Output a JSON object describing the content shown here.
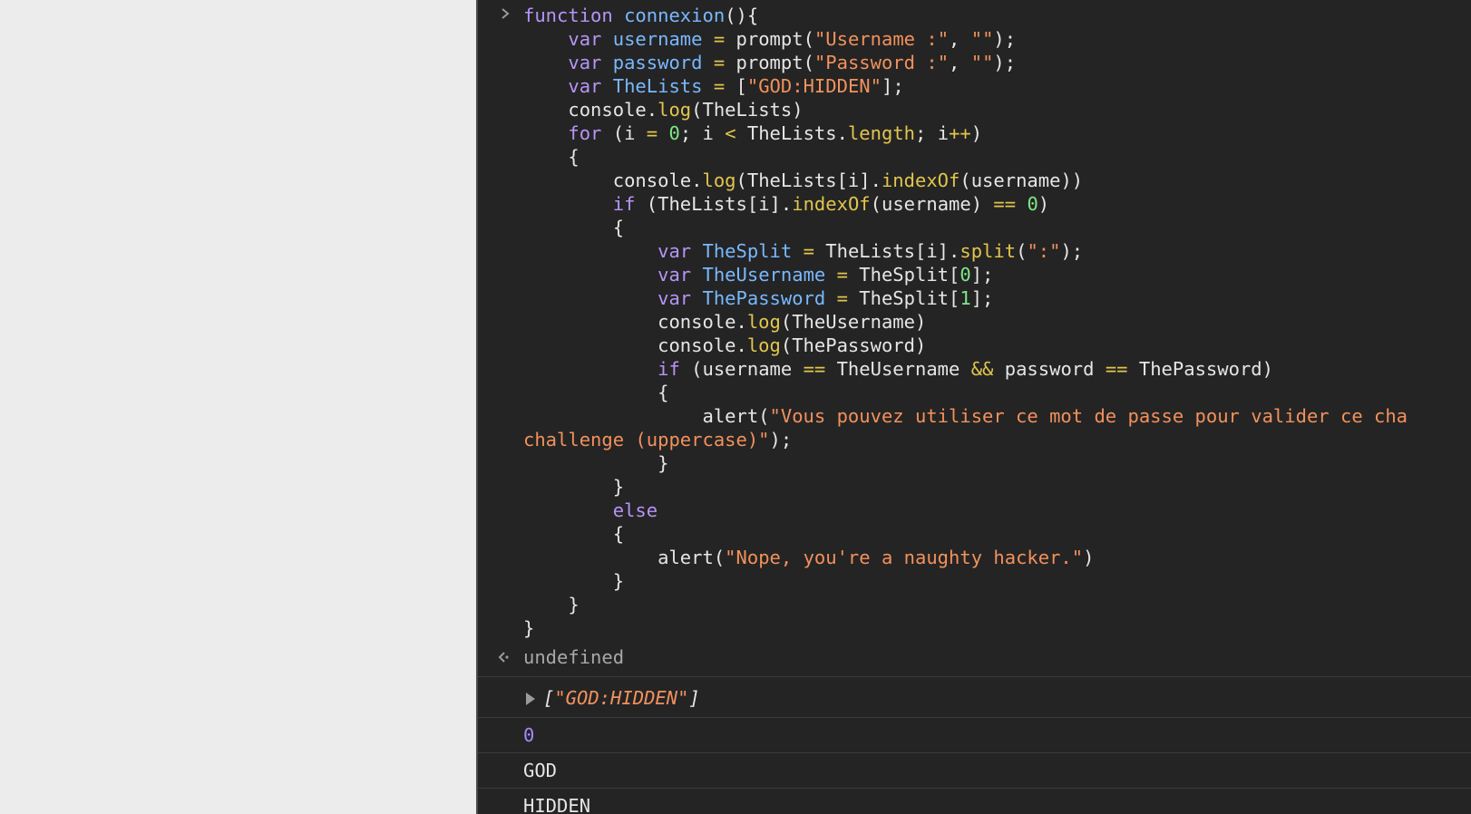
{
  "console": {
    "input_code": [
      [
        [
          "kw",
          "function "
        ],
        [
          "fn",
          "connexion"
        ],
        [
          "plain",
          "(){"
        ]
      ],
      [
        [
          "plain",
          "    "
        ],
        [
          "kw",
          "var "
        ],
        [
          "var",
          "username "
        ],
        [
          "op",
          "= "
        ],
        [
          "plain",
          "prompt("
        ],
        [
          "str",
          "\"Username :\""
        ],
        [
          "plain",
          ", "
        ],
        [
          "str",
          "\"\""
        ],
        [
          "plain",
          ");"
        ]
      ],
      [
        [
          "plain",
          "    "
        ],
        [
          "kw",
          "var "
        ],
        [
          "var",
          "password "
        ],
        [
          "op",
          "= "
        ],
        [
          "plain",
          "prompt("
        ],
        [
          "str",
          "\"Password :\""
        ],
        [
          "plain",
          ", "
        ],
        [
          "str",
          "\"\""
        ],
        [
          "plain",
          ");"
        ]
      ],
      [
        [
          "plain",
          "    "
        ],
        [
          "kw",
          "var "
        ],
        [
          "var",
          "TheLists "
        ],
        [
          "op",
          "= "
        ],
        [
          "plain",
          "["
        ],
        [
          "str",
          "\"GOD:HIDDEN\""
        ],
        [
          "plain",
          "];"
        ]
      ],
      [
        [
          "plain",
          "    console."
        ],
        [
          "method",
          "log"
        ],
        [
          "plain",
          "(TheLists)"
        ]
      ],
      [
        [
          "plain",
          "    "
        ],
        [
          "kw",
          "for "
        ],
        [
          "plain",
          "(i "
        ],
        [
          "op",
          "= "
        ],
        [
          "num",
          "0"
        ],
        [
          "plain",
          "; i "
        ],
        [
          "op",
          "< "
        ],
        [
          "plain",
          "TheLists."
        ],
        [
          "method",
          "length"
        ],
        [
          "plain",
          "; i"
        ],
        [
          "op",
          "++"
        ],
        [
          "plain",
          ")"
        ]
      ],
      [
        [
          "plain",
          "    {"
        ]
      ],
      [
        [
          "plain",
          "        console."
        ],
        [
          "method",
          "log"
        ],
        [
          "plain",
          "(TheLists[i]."
        ],
        [
          "method",
          "indexOf"
        ],
        [
          "plain",
          "(username))"
        ]
      ],
      [
        [
          "plain",
          "        "
        ],
        [
          "kw",
          "if "
        ],
        [
          "plain",
          "(TheLists[i]."
        ],
        [
          "method",
          "indexOf"
        ],
        [
          "plain",
          "(username) "
        ],
        [
          "op",
          "== "
        ],
        [
          "num",
          "0"
        ],
        [
          "plain",
          ")"
        ]
      ],
      [
        [
          "plain",
          "        {"
        ]
      ],
      [
        [
          "plain",
          "            "
        ],
        [
          "kw",
          "var "
        ],
        [
          "var",
          "TheSplit "
        ],
        [
          "op",
          "= "
        ],
        [
          "plain",
          "TheLists[i]."
        ],
        [
          "method",
          "split"
        ],
        [
          "plain",
          "("
        ],
        [
          "str",
          "\":\""
        ],
        [
          "plain",
          ");"
        ]
      ],
      [
        [
          "plain",
          "            "
        ],
        [
          "kw",
          "var "
        ],
        [
          "var",
          "TheUsername "
        ],
        [
          "op",
          "= "
        ],
        [
          "plain",
          "TheSplit["
        ],
        [
          "num",
          "0"
        ],
        [
          "plain",
          "];"
        ]
      ],
      [
        [
          "plain",
          "            "
        ],
        [
          "kw",
          "var "
        ],
        [
          "var",
          "ThePassword "
        ],
        [
          "op",
          "= "
        ],
        [
          "plain",
          "TheSplit["
        ],
        [
          "num",
          "1"
        ],
        [
          "plain",
          "];"
        ]
      ],
      [
        [
          "plain",
          "            console."
        ],
        [
          "method",
          "log"
        ],
        [
          "plain",
          "(TheUsername)"
        ]
      ],
      [
        [
          "plain",
          "            console."
        ],
        [
          "method",
          "log"
        ],
        [
          "plain",
          "(ThePassword)"
        ]
      ],
      [
        [
          "plain",
          "            "
        ],
        [
          "kw",
          "if "
        ],
        [
          "plain",
          "(username "
        ],
        [
          "op",
          "== "
        ],
        [
          "plain",
          "TheUsername "
        ],
        [
          "op",
          "&& "
        ],
        [
          "plain",
          "password "
        ],
        [
          "op",
          "== "
        ],
        [
          "plain",
          "ThePassword)"
        ]
      ],
      [
        [
          "plain",
          "            {"
        ]
      ],
      [
        [
          "plain",
          "                alert("
        ],
        [
          "str",
          "\"Vous pouvez utiliser ce mot de passe pour valider ce cha"
        ]
      ],
      [
        [
          "str",
          "challenge (uppercase)\""
        ],
        [
          "plain",
          ");"
        ]
      ],
      [
        [
          "plain",
          "            }"
        ]
      ],
      [
        [
          "plain",
          "        }"
        ]
      ],
      [
        [
          "plain",
          "        "
        ],
        [
          "kw",
          "else"
        ]
      ],
      [
        [
          "plain",
          "        {"
        ]
      ],
      [
        [
          "plain",
          "            alert("
        ],
        [
          "str",
          "\"Nope, you're a naughty hacker.\""
        ],
        [
          "plain",
          ")"
        ]
      ],
      [
        [
          "plain",
          "        }"
        ]
      ],
      [
        [
          "plain",
          "    }"
        ]
      ],
      [
        [
          "plain",
          "}"
        ]
      ]
    ],
    "return_value": "undefined",
    "array_output": {
      "open": "[",
      "item": "\"GOD:HIDDEN\"",
      "close": "]"
    },
    "log_number": "0",
    "log_username": "GOD",
    "log_password": "HIDDEN"
  },
  "colors": {
    "background": "#242424",
    "keyword": "#b794f6",
    "string": "#f2915c",
    "method": "#e2c54d",
    "number": "#7ee787"
  }
}
